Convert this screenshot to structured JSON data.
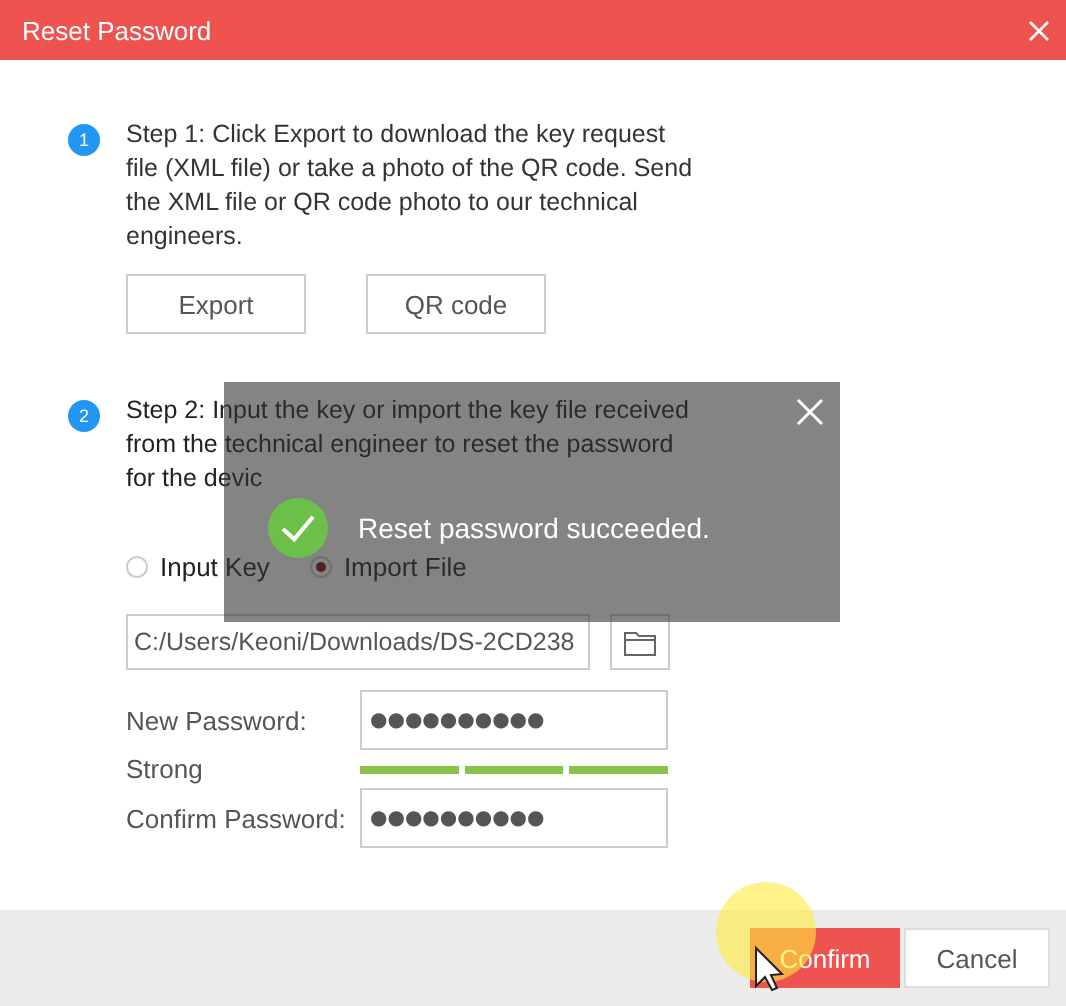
{
  "window": {
    "title": "Reset Password"
  },
  "steps": [
    {
      "number": "1",
      "text": "Step 1: Click Export to download the key request file (XML file) or take a photo of the QR code. Send the XML file or QR code photo to our technical engineers.",
      "buttons": [
        "Export",
        "QR code"
      ]
    },
    {
      "number": "2",
      "text": "Step 2: Input the key or import the key file received from the technical engineer to reset the password for the devic"
    }
  ],
  "radios": [
    {
      "label": "Input Key",
      "selected": false
    },
    {
      "label": "Import File",
      "selected": true
    }
  ],
  "file_path": {
    "value": "C:/Users/Keoni/Downloads/DS-2CD238"
  },
  "new_password": {
    "label": "New Password:",
    "value": "●●●●●●●●●●"
  },
  "strength": {
    "label": "Strong",
    "level": 1
  },
  "confirm_password": {
    "label": "Confirm Password:",
    "value": "●●●●●●●●●●"
  },
  "footer_buttons": [
    {
      "label": "Confirm",
      "kind": "primary"
    },
    {
      "label": "Cancel",
      "kind": "secondary"
    }
  ],
  "toast": {
    "message": "Reset password succeeded."
  }
}
